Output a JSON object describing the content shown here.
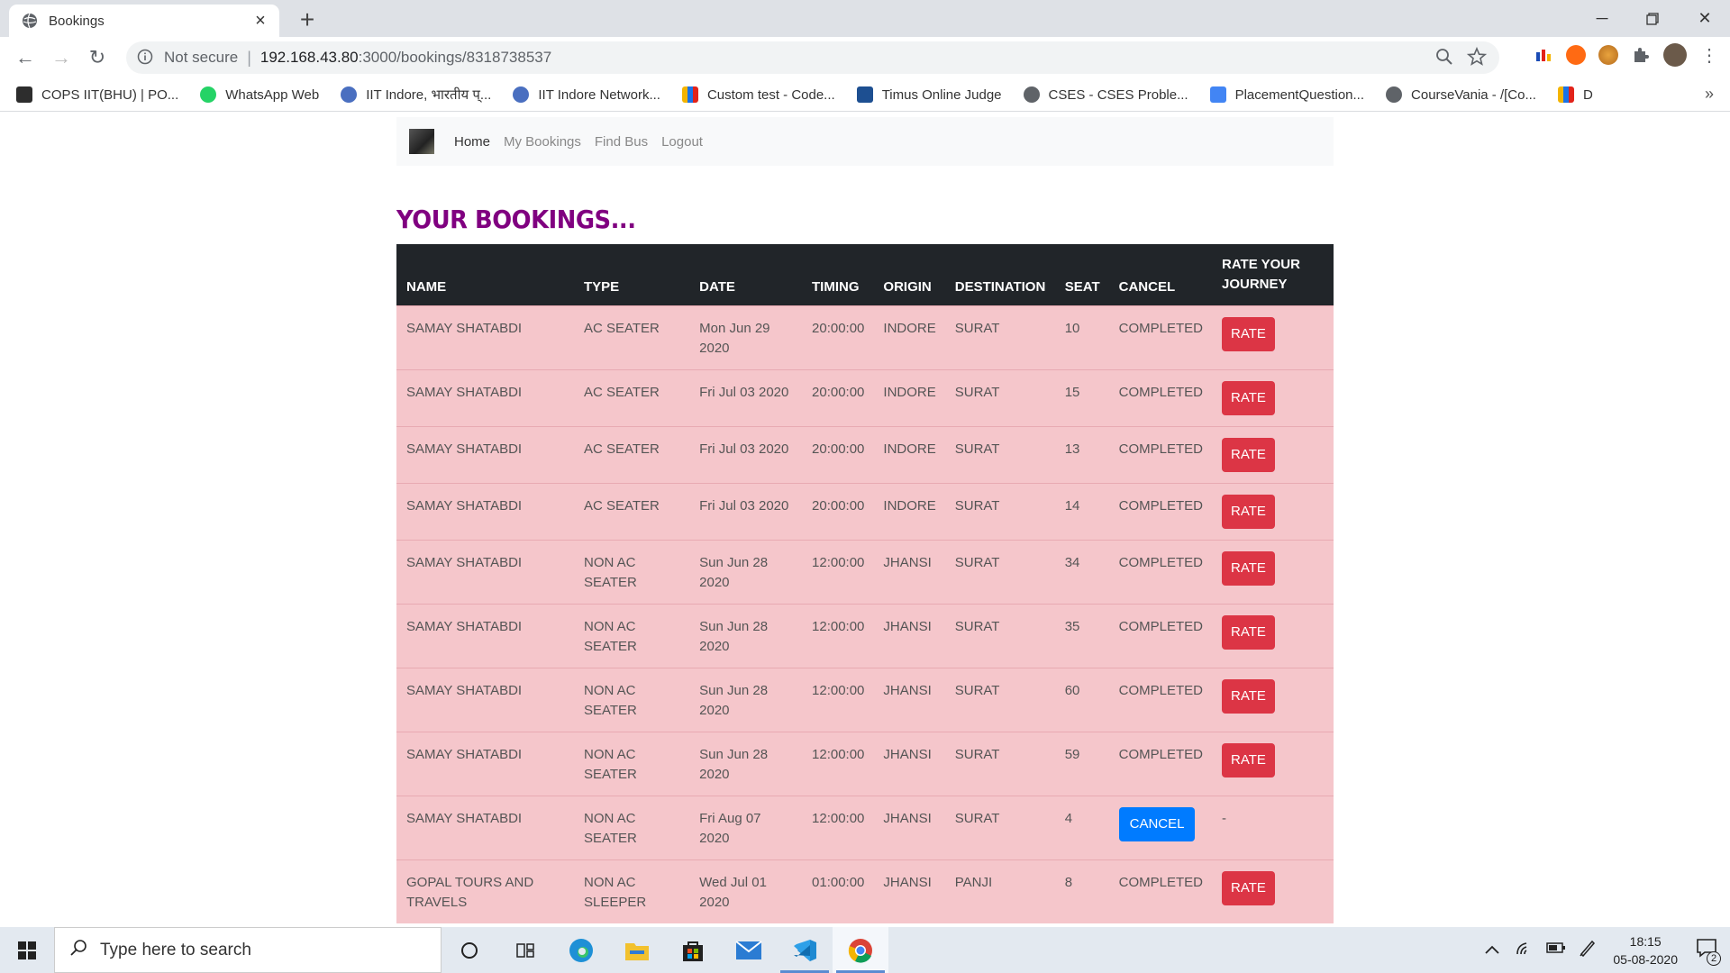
{
  "browser": {
    "tab_title": "Bookings",
    "new_tab": "+",
    "security_label": "Not secure",
    "url_host": "192.168.43.80",
    "url_path": ":3000/bookings/8318738537"
  },
  "bookmarks": [
    {
      "label": "COPS IIT(BHU) | PO...",
      "color": "#2d2d2d"
    },
    {
      "label": "WhatsApp Web",
      "color": "#25d366"
    },
    {
      "label": "IIT Indore, भारतीय प्...",
      "color": "#4a6fc0"
    },
    {
      "label": "IIT Indore Network...",
      "color": "#4a6fc0"
    },
    {
      "label": "Custom test - Code...",
      "color": "#f4b400"
    },
    {
      "label": "Timus Online Judge",
      "color": "#1d4f91"
    },
    {
      "label": "CSES - CSES Proble...",
      "color": "#5f6368"
    },
    {
      "label": "PlacementQuestion...",
      "color": "#4285f4"
    },
    {
      "label": "CourseVania - /[Co...",
      "color": "#5f6368"
    },
    {
      "label": "D",
      "color": "#f4b400"
    }
  ],
  "nav": {
    "home": "Home",
    "my_bookings": "My Bookings",
    "find_bus": "Find Bus",
    "logout": "Logout"
  },
  "heading": "YOUR BOOKINGS...",
  "table": {
    "headers": {
      "name": "NAME",
      "type": "TYPE",
      "date": "DATE",
      "timing": "TIMING",
      "origin": "ORIGIN",
      "destination": "DESTINATION",
      "seat": "SEAT",
      "cancel": "CANCEL",
      "rate": "RATE YOUR JOURNEY"
    },
    "rows": [
      {
        "name": "SAMAY SHATABDI",
        "type": "AC SEATER",
        "date": "Mon Jun 29 2020",
        "timing": "20:00:00",
        "origin": "INDORE",
        "destination": "SURAT",
        "seat": "10",
        "cancel": "COMPLETED",
        "rate": "RATE"
      },
      {
        "name": "SAMAY SHATABDI",
        "type": "AC SEATER",
        "date": "Fri Jul 03 2020",
        "timing": "20:00:00",
        "origin": "INDORE",
        "destination": "SURAT",
        "seat": "15",
        "cancel": "COMPLETED",
        "rate": "RATE"
      },
      {
        "name": "SAMAY SHATABDI",
        "type": "AC SEATER",
        "date": "Fri Jul 03 2020",
        "timing": "20:00:00",
        "origin": "INDORE",
        "destination": "SURAT",
        "seat": "13",
        "cancel": "COMPLETED",
        "rate": "RATE"
      },
      {
        "name": "SAMAY SHATABDI",
        "type": "AC SEATER",
        "date": "Fri Jul 03 2020",
        "timing": "20:00:00",
        "origin": "INDORE",
        "destination": "SURAT",
        "seat": "14",
        "cancel": "COMPLETED",
        "rate": "RATE"
      },
      {
        "name": "SAMAY SHATABDI",
        "type": "NON AC SEATER",
        "date": "Sun Jun 28 2020",
        "timing": "12:00:00",
        "origin": "JHANSI",
        "destination": "SURAT",
        "seat": "34",
        "cancel": "COMPLETED",
        "rate": "RATE"
      },
      {
        "name": "SAMAY SHATABDI",
        "type": "NON AC SEATER",
        "date": "Sun Jun 28 2020",
        "timing": "12:00:00",
        "origin": "JHANSI",
        "destination": "SURAT",
        "seat": "35",
        "cancel": "COMPLETED",
        "rate": "RATE"
      },
      {
        "name": "SAMAY SHATABDI",
        "type": "NON AC SEATER",
        "date": "Sun Jun 28 2020",
        "timing": "12:00:00",
        "origin": "JHANSI",
        "destination": "SURAT",
        "seat": "60",
        "cancel": "COMPLETED",
        "rate": "RATE"
      },
      {
        "name": "SAMAY SHATABDI",
        "type": "NON AC SEATER",
        "date": "Sun Jun 28 2020",
        "timing": "12:00:00",
        "origin": "JHANSI",
        "destination": "SURAT",
        "seat": "59",
        "cancel": "COMPLETED",
        "rate": "RATE"
      },
      {
        "name": "SAMAY SHATABDI",
        "type": "NON AC SEATER",
        "date": "Fri Aug 07 2020",
        "timing": "12:00:00",
        "origin": "JHANSI",
        "destination": "SURAT",
        "seat": "4",
        "cancel": "CANCEL",
        "rate": "-"
      },
      {
        "name": "GOPAL TOURS AND TRAVELS",
        "type": "NON AC SLEEPER",
        "date": "Wed Jul 01 2020",
        "timing": "01:00:00",
        "origin": "JHANSI",
        "destination": "PANJI",
        "seat": "8",
        "cancel": "COMPLETED",
        "rate": "RATE"
      }
    ]
  },
  "taskbar": {
    "search_placeholder": "Type here to search",
    "time": "18:15",
    "date": "05-08-2020",
    "notifications": "2"
  },
  "colors": {
    "heading": "#800080",
    "row_bg": "#f5c6cb",
    "header_bg": "#212529",
    "rate_button": "#dc3545",
    "cancel_button": "#007bff"
  }
}
